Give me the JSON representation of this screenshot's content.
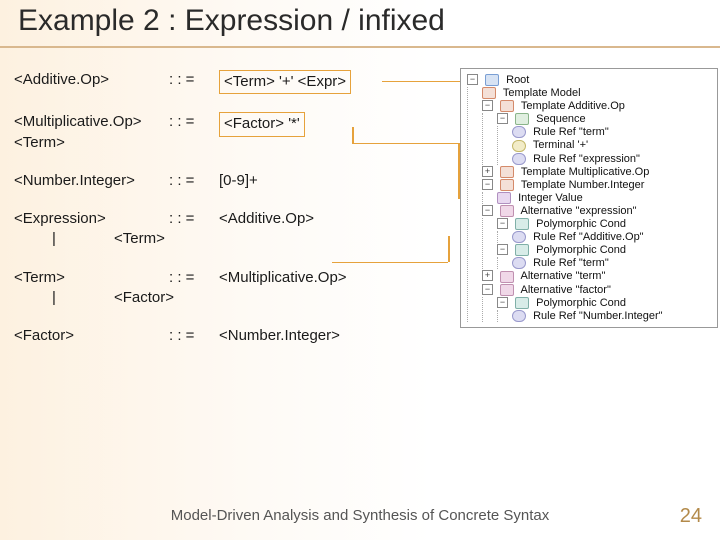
{
  "title": "Example 2 : Expression / infixed",
  "grammar": {
    "r1": {
      "lhs": "<Additive.Op>",
      "op": ": : =",
      "rhs_box": "<Term> '+' <Expr>"
    },
    "r2": {
      "lhs_line1": "<Multiplicative.Op>",
      "lhs_line2": "<Term>",
      "op": ": : =",
      "rhs_box": "<Factor> '*'"
    },
    "r3": {
      "lhs": "<Number.Integer>",
      "op": ": : =",
      "rhs": "[0-9]+"
    },
    "r4": {
      "lhs": "<Expression>",
      "op": ": : =",
      "rhs1": "<Additive.Op>",
      "pipe": "|",
      "rhs2": "<Term>"
    },
    "r5": {
      "lhs": "<Term>",
      "op": ": : =",
      "rhs1": "<Multiplicative.Op>",
      "pipe": "|",
      "rhs2": "<Factor>"
    },
    "r6": {
      "lhs": "<Factor>",
      "op": ": : =",
      "rhs": "<Number.Integer>"
    }
  },
  "tree": {
    "root": "Root",
    "n1": "Template Model",
    "n2": "Template Additive.Op",
    "n2a": "Sequence",
    "n2a1": "Rule Ref \"term\"",
    "n2a2": "Terminal '+'",
    "n2a3": "Rule Ref \"expression\"",
    "n3": "Template Multiplicative.Op",
    "n4": "Template Number.Integer",
    "n4a": "Integer Value",
    "n5": "Alternative \"expression\"",
    "n5a": "Polymorphic Cond",
    "n5a1": "Rule Ref \"Additive.Op\"",
    "n5b": "Polymorphic Cond",
    "n5b1": "Rule Ref \"term\"",
    "n6": "Alternative \"term\"",
    "n7": "Alternative \"factor\"",
    "n7a": "Polymorphic Cond",
    "n7a1": "Rule Ref \"Number.Integer\""
  },
  "toggles": {
    "minus": "−",
    "plus": "+"
  },
  "footer": "Model-Driven Analysis and Synthesis of Concrete Syntax",
  "page": "24"
}
